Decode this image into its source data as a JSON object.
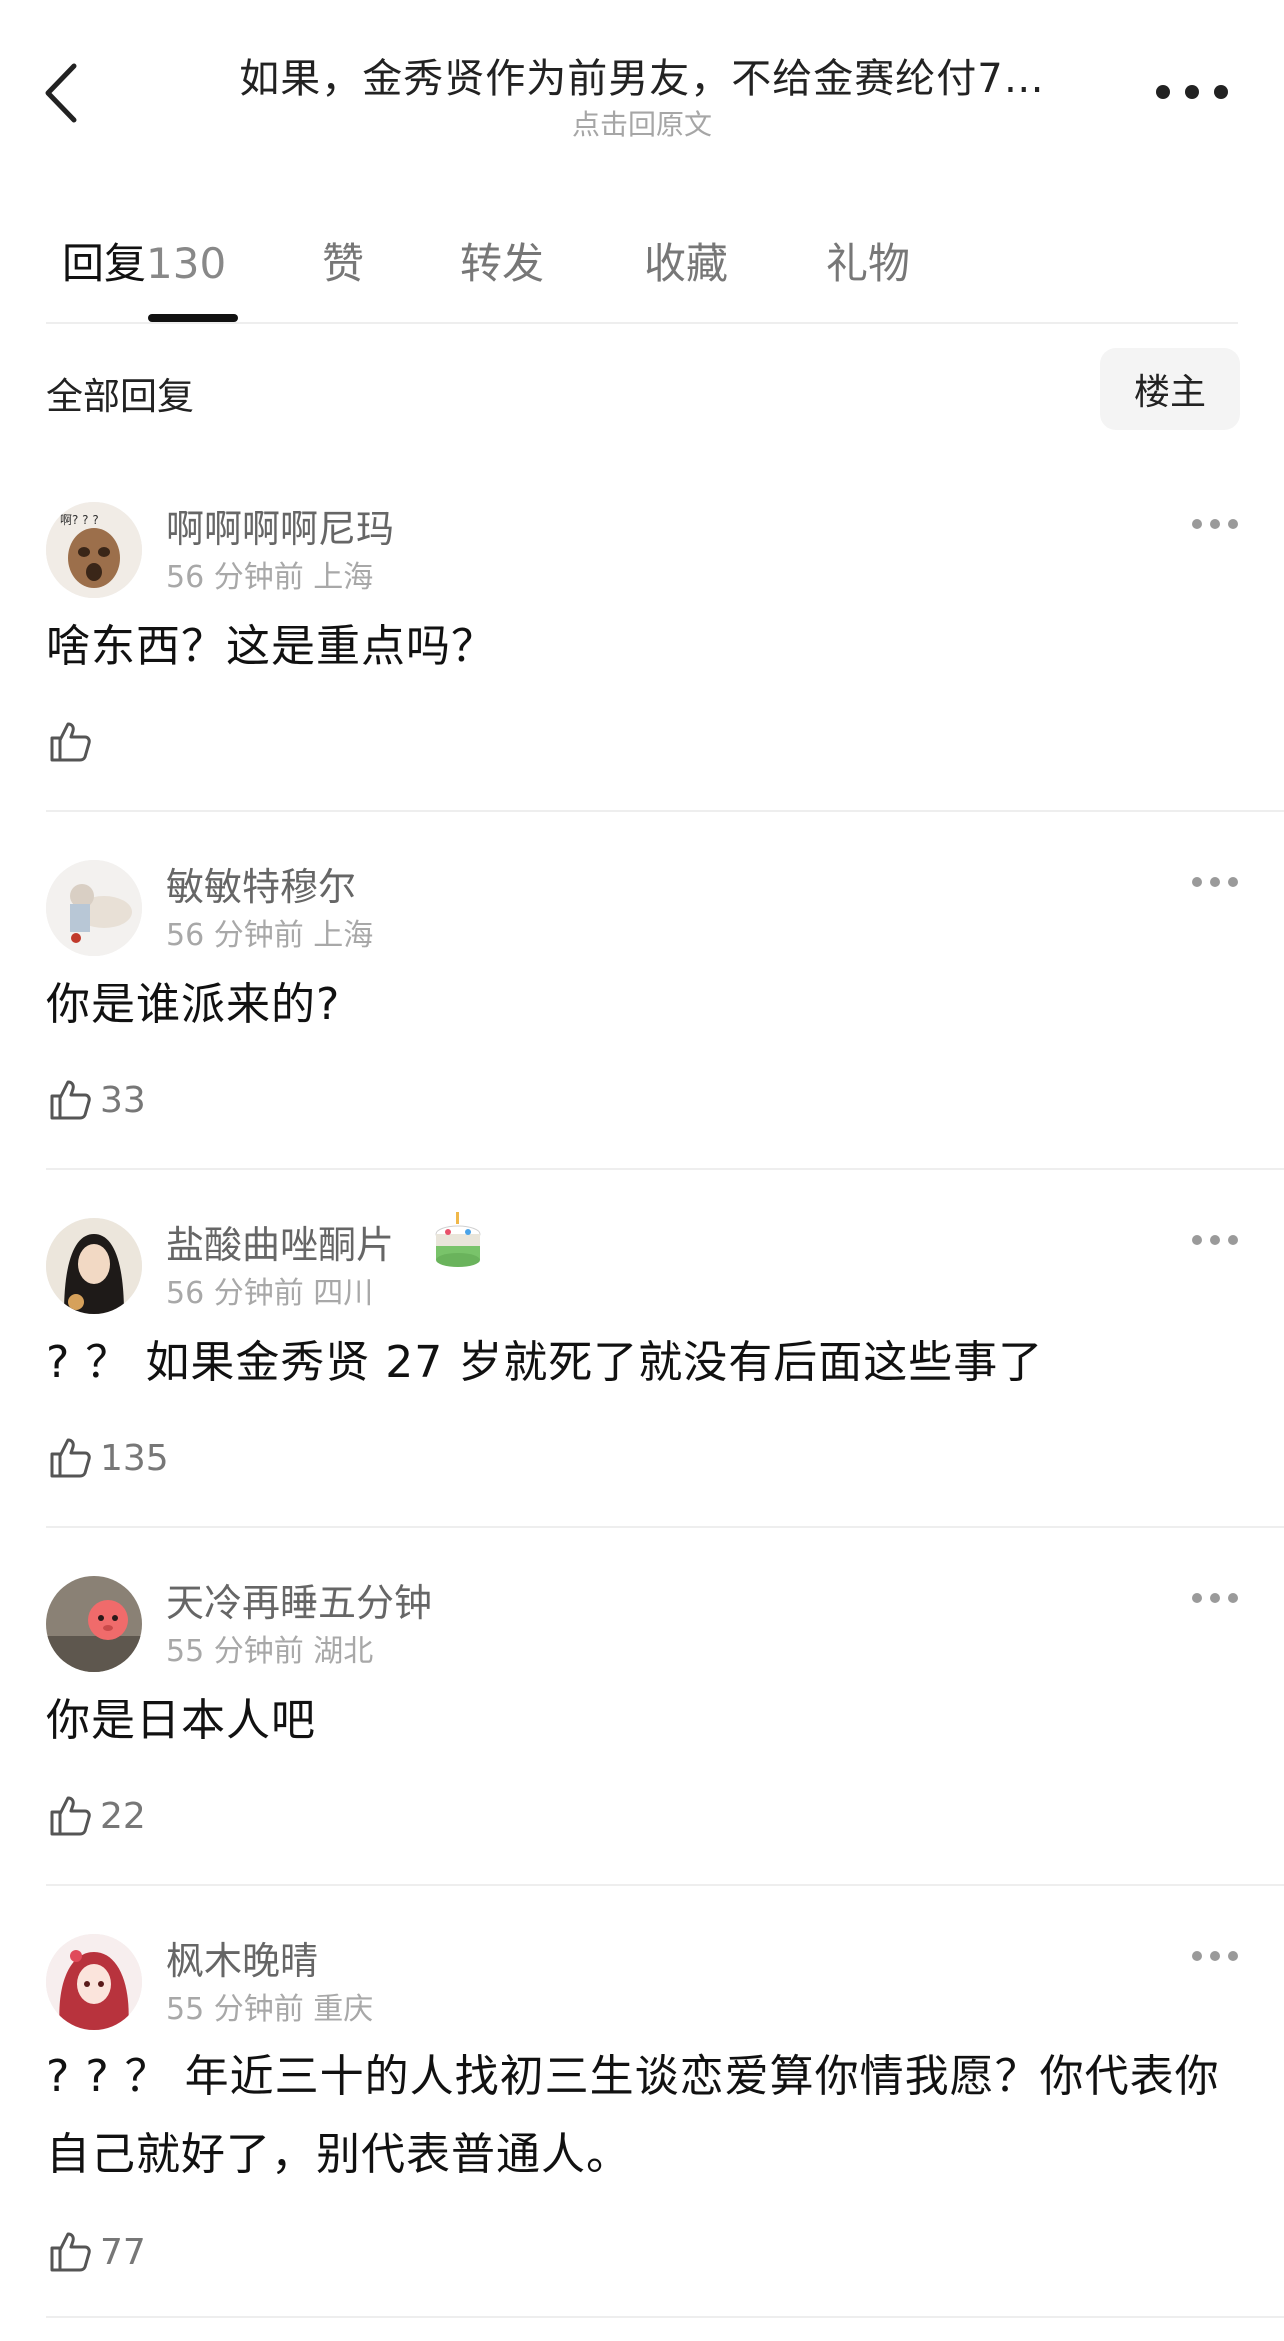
{
  "header": {
    "title": "如果，金秀贤作为前男友，不给金赛纶付7…",
    "subtitle": "点击回原文"
  },
  "tabs": [
    {
      "label": "回复",
      "count": "130",
      "active": true
    },
    {
      "label": "赞",
      "count": "",
      "active": false
    },
    {
      "label": "转发",
      "count": "",
      "active": false
    },
    {
      "label": "收藏",
      "count": "",
      "active": false
    },
    {
      "label": "礼物",
      "count": "",
      "active": false
    }
  ],
  "filter": {
    "label": "全部回复",
    "owner_button": "楼主"
  },
  "comments": [
    {
      "user": "啊啊啊啊尼玛",
      "avatar_text": "啊? ? ?",
      "time": "56 分钟前",
      "location": "上海",
      "text": "啥东西？这是重点吗？",
      "likes": ""
    },
    {
      "user": "敏敏特穆尔",
      "time": "56 分钟前",
      "location": "上海",
      "text": "你是谁派来的?",
      "likes": "33"
    },
    {
      "user": "盐酸曲唑酮片",
      "time": "56 分钟前",
      "location": "四川",
      "text": "? ？ 如果金秀贤 27 岁就死了就没有后面这些事了",
      "likes": "135",
      "badge_icon": "birthday-cake-icon"
    },
    {
      "user": "天冷再睡五分钟",
      "time": "55 分钟前",
      "location": "湖北",
      "text": "你是日本人吧",
      "likes": "22"
    },
    {
      "user": "枫木晚晴",
      "time": "55 分钟前",
      "location": "重庆",
      "text": "? ? ？ 年近三十的人找初三生谈恋爱算你情我愿？你代表你自己就好了，别代表普通人。",
      "likes": "77"
    }
  ],
  "icons": {
    "back": "back-arrow-icon",
    "more": "more-icon",
    "like": "thumbs-up-icon"
  },
  "colors": {
    "primary_text": "#111111",
    "secondary_text": "#666666",
    "meta_text": "#a8a8a8",
    "divider": "#eeeeee"
  }
}
